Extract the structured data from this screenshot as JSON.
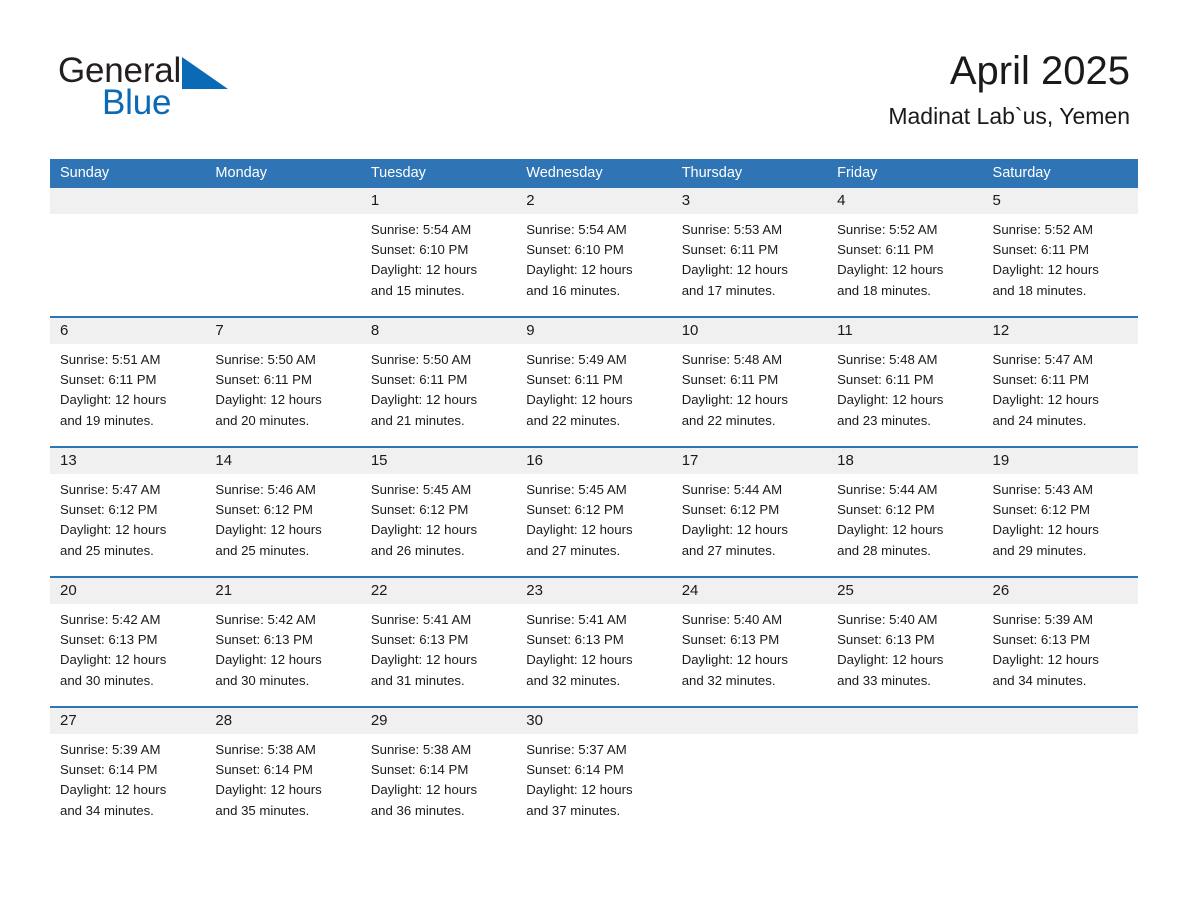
{
  "logo": {
    "word1": "General",
    "word2": "Blue",
    "triangle_icon": "blue-triangle-icon",
    "accent_color": "#0a6ab5"
  },
  "header": {
    "title": "April 2025",
    "subtitle": "Madinat Lab`us, Yemen",
    "header_bg": "#2f75b5",
    "date_band_bg": "#f0f0f0"
  },
  "weekday_headers": [
    "Sunday",
    "Monday",
    "Tuesday",
    "Wednesday",
    "Thursday",
    "Friday",
    "Saturday"
  ],
  "weeks": [
    {
      "dates": [
        "",
        "",
        "1",
        "2",
        "3",
        "4",
        "5"
      ],
      "cells": [
        {
          "lines": []
        },
        {
          "lines": []
        },
        {
          "lines": [
            "Sunrise: 5:54 AM",
            "Sunset: 6:10 PM",
            "Daylight: 12 hours",
            "and 15 minutes."
          ]
        },
        {
          "lines": [
            "Sunrise: 5:54 AM",
            "Sunset: 6:10 PM",
            "Daylight: 12 hours",
            "and 16 minutes."
          ]
        },
        {
          "lines": [
            "Sunrise: 5:53 AM",
            "Sunset: 6:11 PM",
            "Daylight: 12 hours",
            "and 17 minutes."
          ]
        },
        {
          "lines": [
            "Sunrise: 5:52 AM",
            "Sunset: 6:11 PM",
            "Daylight: 12 hours",
            "and 18 minutes."
          ]
        },
        {
          "lines": [
            "Sunrise: 5:52 AM",
            "Sunset: 6:11 PM",
            "Daylight: 12 hours",
            "and 18 minutes."
          ]
        }
      ]
    },
    {
      "dates": [
        "6",
        "7",
        "8",
        "9",
        "10",
        "11",
        "12"
      ],
      "cells": [
        {
          "lines": [
            "Sunrise: 5:51 AM",
            "Sunset: 6:11 PM",
            "Daylight: 12 hours",
            "and 19 minutes."
          ]
        },
        {
          "lines": [
            "Sunrise: 5:50 AM",
            "Sunset: 6:11 PM",
            "Daylight: 12 hours",
            "and 20 minutes."
          ]
        },
        {
          "lines": [
            "Sunrise: 5:50 AM",
            "Sunset: 6:11 PM",
            "Daylight: 12 hours",
            "and 21 minutes."
          ]
        },
        {
          "lines": [
            "Sunrise: 5:49 AM",
            "Sunset: 6:11 PM",
            "Daylight: 12 hours",
            "and 22 minutes."
          ]
        },
        {
          "lines": [
            "Sunrise: 5:48 AM",
            "Sunset: 6:11 PM",
            "Daylight: 12 hours",
            "and 22 minutes."
          ]
        },
        {
          "lines": [
            "Sunrise: 5:48 AM",
            "Sunset: 6:11 PM",
            "Daylight: 12 hours",
            "and 23 minutes."
          ]
        },
        {
          "lines": [
            "Sunrise: 5:47 AM",
            "Sunset: 6:11 PM",
            "Daylight: 12 hours",
            "and 24 minutes."
          ]
        }
      ]
    },
    {
      "dates": [
        "13",
        "14",
        "15",
        "16",
        "17",
        "18",
        "19"
      ],
      "cells": [
        {
          "lines": [
            "Sunrise: 5:47 AM",
            "Sunset: 6:12 PM",
            "Daylight: 12 hours",
            "and 25 minutes."
          ]
        },
        {
          "lines": [
            "Sunrise: 5:46 AM",
            "Sunset: 6:12 PM",
            "Daylight: 12 hours",
            "and 25 minutes."
          ]
        },
        {
          "lines": [
            "Sunrise: 5:45 AM",
            "Sunset: 6:12 PM",
            "Daylight: 12 hours",
            "and 26 minutes."
          ]
        },
        {
          "lines": [
            "Sunrise: 5:45 AM",
            "Sunset: 6:12 PM",
            "Daylight: 12 hours",
            "and 27 minutes."
          ]
        },
        {
          "lines": [
            "Sunrise: 5:44 AM",
            "Sunset: 6:12 PM",
            "Daylight: 12 hours",
            "and 27 minutes."
          ]
        },
        {
          "lines": [
            "Sunrise: 5:44 AM",
            "Sunset: 6:12 PM",
            "Daylight: 12 hours",
            "and 28 minutes."
          ]
        },
        {
          "lines": [
            "Sunrise: 5:43 AM",
            "Sunset: 6:12 PM",
            "Daylight: 12 hours",
            "and 29 minutes."
          ]
        }
      ]
    },
    {
      "dates": [
        "20",
        "21",
        "22",
        "23",
        "24",
        "25",
        "26"
      ],
      "cells": [
        {
          "lines": [
            "Sunrise: 5:42 AM",
            "Sunset: 6:13 PM",
            "Daylight: 12 hours",
            "and 30 minutes."
          ]
        },
        {
          "lines": [
            "Sunrise: 5:42 AM",
            "Sunset: 6:13 PM",
            "Daylight: 12 hours",
            "and 30 minutes."
          ]
        },
        {
          "lines": [
            "Sunrise: 5:41 AM",
            "Sunset: 6:13 PM",
            "Daylight: 12 hours",
            "and 31 minutes."
          ]
        },
        {
          "lines": [
            "Sunrise: 5:41 AM",
            "Sunset: 6:13 PM",
            "Daylight: 12 hours",
            "and 32 minutes."
          ]
        },
        {
          "lines": [
            "Sunrise: 5:40 AM",
            "Sunset: 6:13 PM",
            "Daylight: 12 hours",
            "and 32 minutes."
          ]
        },
        {
          "lines": [
            "Sunrise: 5:40 AM",
            "Sunset: 6:13 PM",
            "Daylight: 12 hours",
            "and 33 minutes."
          ]
        },
        {
          "lines": [
            "Sunrise: 5:39 AM",
            "Sunset: 6:13 PM",
            "Daylight: 12 hours",
            "and 34 minutes."
          ]
        }
      ]
    },
    {
      "dates": [
        "27",
        "28",
        "29",
        "30",
        "",
        "",
        ""
      ],
      "cells": [
        {
          "lines": [
            "Sunrise: 5:39 AM",
            "Sunset: 6:14 PM",
            "Daylight: 12 hours",
            "and 34 minutes."
          ]
        },
        {
          "lines": [
            "Sunrise: 5:38 AM",
            "Sunset: 6:14 PM",
            "Daylight: 12 hours",
            "and 35 minutes."
          ]
        },
        {
          "lines": [
            "Sunrise: 5:38 AM",
            "Sunset: 6:14 PM",
            "Daylight: 12 hours",
            "and 36 minutes."
          ]
        },
        {
          "lines": [
            "Sunrise: 5:37 AM",
            "Sunset: 6:14 PM",
            "Daylight: 12 hours",
            "and 37 minutes."
          ]
        },
        {
          "lines": []
        },
        {
          "lines": []
        },
        {
          "lines": []
        }
      ]
    }
  ]
}
